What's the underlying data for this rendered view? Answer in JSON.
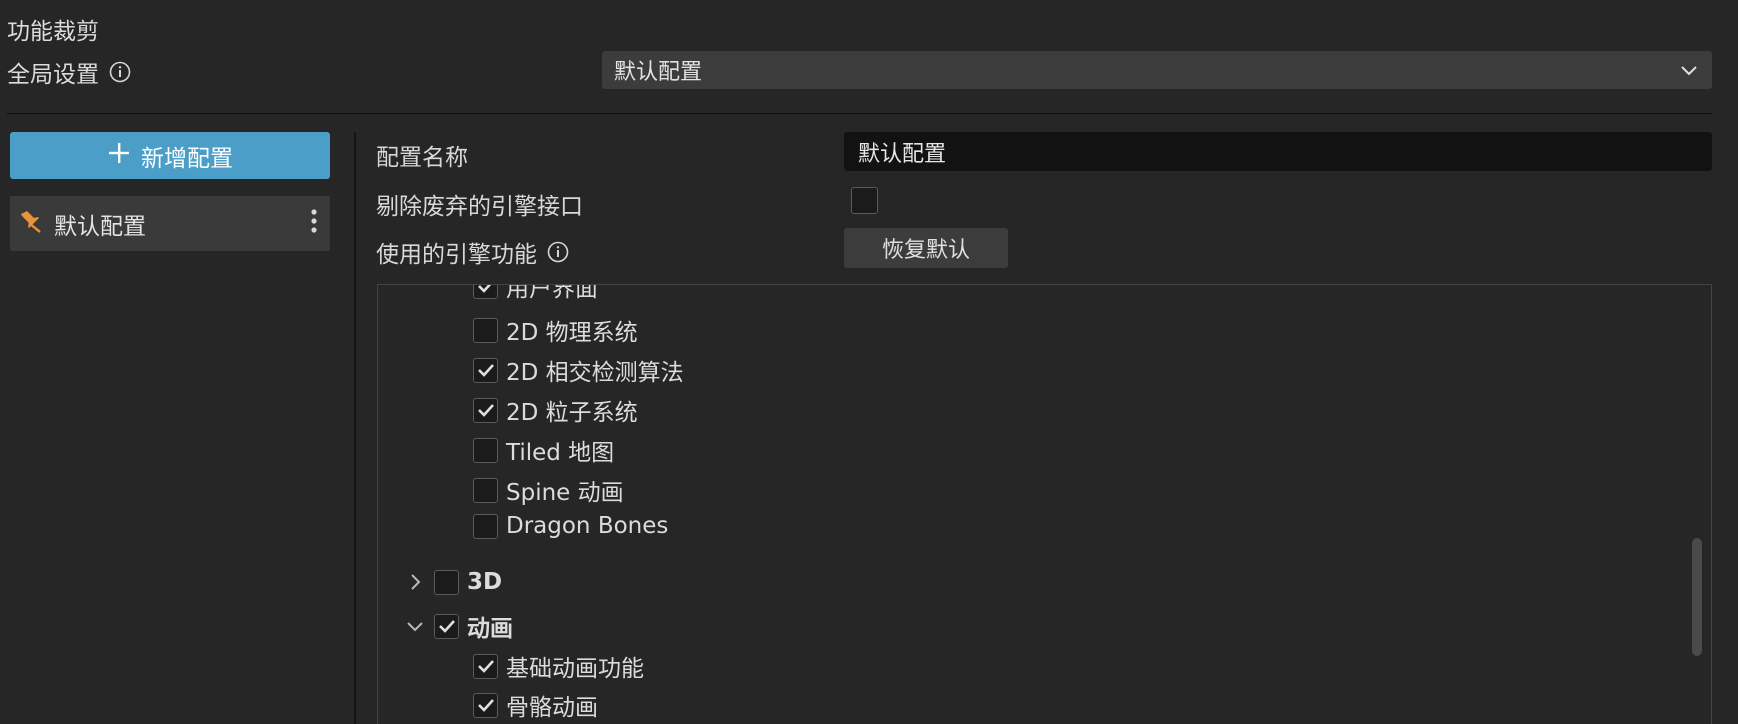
{
  "header": {
    "title": "功能裁剪",
    "global_label": "全局设置",
    "global_select_value": "默认配置"
  },
  "sidebar": {
    "add_button_label": "新增配置",
    "items": [
      {
        "label": "默认配置"
      }
    ]
  },
  "form": {
    "name_label": "配置名称",
    "name_value": "默认配置",
    "remove_deprecated_label": "剔除废弃的引擎接口",
    "remove_deprecated_checked": false,
    "engine_features_label": "使用的引擎功能",
    "reset_button_label": "恢复默认"
  },
  "modules": {
    "items": [
      {
        "label": "用户界面",
        "checked": true
      },
      {
        "label": "2D 物理系统",
        "checked": false
      },
      {
        "label": "2D 相交检测算法",
        "checked": true
      },
      {
        "label": "2D 粒子系统",
        "checked": true
      },
      {
        "label": "Tiled 地图",
        "checked": false
      },
      {
        "label": "Spine 动画",
        "checked": false
      },
      {
        "label": "Dragon Bones",
        "checked": false
      }
    ],
    "groups": [
      {
        "label": "3D",
        "checked": false,
        "expanded": false
      },
      {
        "label": "动画",
        "checked": true,
        "expanded": true
      }
    ],
    "animation_items": [
      {
        "label": "基础动画功能",
        "checked": true
      },
      {
        "label": "骨骼动画",
        "checked": true
      }
    ]
  },
  "colors": {
    "accent": "#4b9ec7",
    "background": "#262626",
    "pin_icon": "#e8943a"
  },
  "icons": {
    "info": "info-circle-icon",
    "dropdown": "chevron-down-icon",
    "add": "plus-icon",
    "pin": "pin-icon",
    "more": "more-vertical-icon",
    "check": "checkmark-icon",
    "expand": "chevron-right-icon",
    "collapse": "chevron-down-icon"
  }
}
